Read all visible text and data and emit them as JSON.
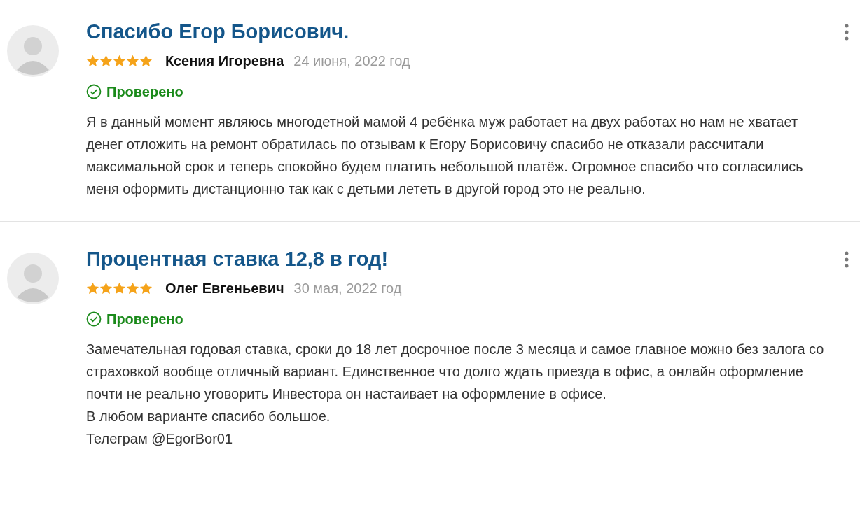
{
  "reviews": [
    {
      "title": "Спасибо Егор Борисович.",
      "stars": 5,
      "author": "Ксения Игоревна",
      "date": "24 июня, 2022 год",
      "verified": true,
      "verified_label": "Проверено",
      "body": "Я в данный момент являюсь многодетной мамой 4 ребёнка муж работает на двух работах но нам не хватает денег отложить на ремонт обратилась по отзывам к Егору Борисовичу спасибо не отказали рассчитали максимальной срок и теперь спокойно будем платить небольшой платёж. Огромное спасибо что согласились меня оформить дистанционно так как с детьми лететь в другой город это не реально."
    },
    {
      "title": "Процентная ставка 12,8 в год!",
      "stars": 5,
      "author": "Олег Евгеньевич",
      "date": "30 мая, 2022 год",
      "verified": true,
      "verified_label": "Проверено",
      "body": "Замечательная годовая ставка, сроки до 18 лет досрочное после 3 месяца и самое главное можно без залога со страховкой вообще отличный вариант. Единственное что долго ждать приезда в офис, а онлайн оформление почти не реально уговорить Инвестора он настаивает на оформление в офисе.\nВ любом варианте спасибо большое.\nТелеграм @EgorBor01"
    }
  ]
}
